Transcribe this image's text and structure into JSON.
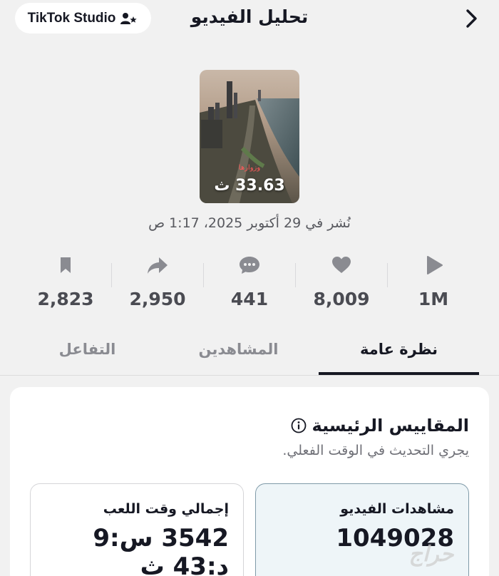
{
  "header": {
    "studio_label": "TikTok Studio",
    "title": "تحليل الفيديو"
  },
  "video": {
    "caption_overlay": "وزوارها",
    "duration": "33.63 ث",
    "posted": "نُشر في 29 أكتوبر 2025، 1:17 ص"
  },
  "stats": [
    {
      "icon": "play-icon",
      "value": "1M"
    },
    {
      "icon": "heart-icon",
      "value": "8,009"
    },
    {
      "icon": "comment-icon",
      "value": "441"
    },
    {
      "icon": "share-icon",
      "value": "2,950"
    },
    {
      "icon": "bookmark-icon",
      "value": "2,823"
    }
  ],
  "tabs": [
    {
      "label": "نظرة عامة",
      "active": true
    },
    {
      "label": "المشاهدين",
      "active": false
    },
    {
      "label": "التفاعل",
      "active": false
    }
  ],
  "key_metrics": {
    "title": "المقاييس الرئيسية",
    "subtitle": "يجري التحديث في الوقت الفعلي.",
    "cards": [
      {
        "label": "مشاهدات الفيديو",
        "value": "1049028",
        "highlighted": true
      },
      {
        "label": "إجمالي وقت اللعب",
        "value": "3542 س:9 د:43 ث",
        "highlighted": false
      }
    ]
  },
  "watermark": "حراج",
  "colors": {
    "background": "#f1f1f1",
    "text": "#161823",
    "muted": "#8a8b91",
    "highlight_card": "#eef5f8"
  }
}
